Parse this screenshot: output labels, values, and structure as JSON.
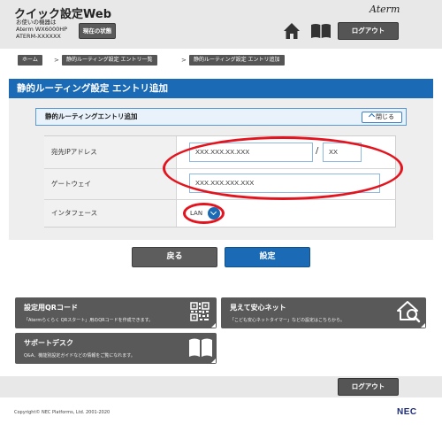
{
  "header": {
    "app_title": "クイック設定Web",
    "device_info_line1": "お使いの機器は",
    "device_info_line2": "Aterm WX6000HP",
    "device_info_line3": "ATERM-XXXXXX",
    "status_button": "現在の状態",
    "brand_logo": "Aterm",
    "logout_label": "ログアウト",
    "home_icon": "home-icon",
    "book_icon": "book-icon"
  },
  "breadcrumb": {
    "items": [
      "ホーム",
      "静的ルーティング設定 エントリ一覧",
      "静的ルーティング設定 エントリ追加"
    ],
    "separator": ">"
  },
  "page_title": "静的ルーティング設定 エントリ追加",
  "section": {
    "title": "静的ルーティングエントリ追加",
    "close_label": "閉じる"
  },
  "form": {
    "dest_ip_label": "宛先IPアドレス",
    "dest_ip_value": "XXX.XXX.XX.XXX",
    "prefix_separator": "/",
    "prefix_value": "XX",
    "gateway_label": "ゲートウェイ",
    "gateway_value": "XXX.XXX.XXX.XXX",
    "interface_label": "インタフェース",
    "interface_value": "LAN"
  },
  "buttons": {
    "back_label": "戻る",
    "submit_label": "設定"
  },
  "tiles": {
    "qr": {
      "title": "設定用QRコード",
      "desc": "「Atermらくらく QRスタート」用のQRコードを作成できます。",
      "icon": "qr-code-icon"
    },
    "safe_net": {
      "title": "見えて安心ネット",
      "desc": "「こども安心ネットタイマー」などの設定はこちらから。",
      "icon": "house-search-icon"
    },
    "support": {
      "title": "サポートデスク",
      "desc": "Q&A、機能別設定ガイドなどの情報をご覧になれます。",
      "icon": "open-book-icon"
    }
  },
  "footer": {
    "logout_label": "ログアウト",
    "copyright": "Copyright© NEC Platforms, Ltd. 2001-2020",
    "nec_logo": "NEC"
  },
  "colors": {
    "brand_blue": "#1a6ab5",
    "dark_button": "#595959",
    "annotation_red": "#e3141e",
    "header_gray": "#e8e8e8"
  }
}
